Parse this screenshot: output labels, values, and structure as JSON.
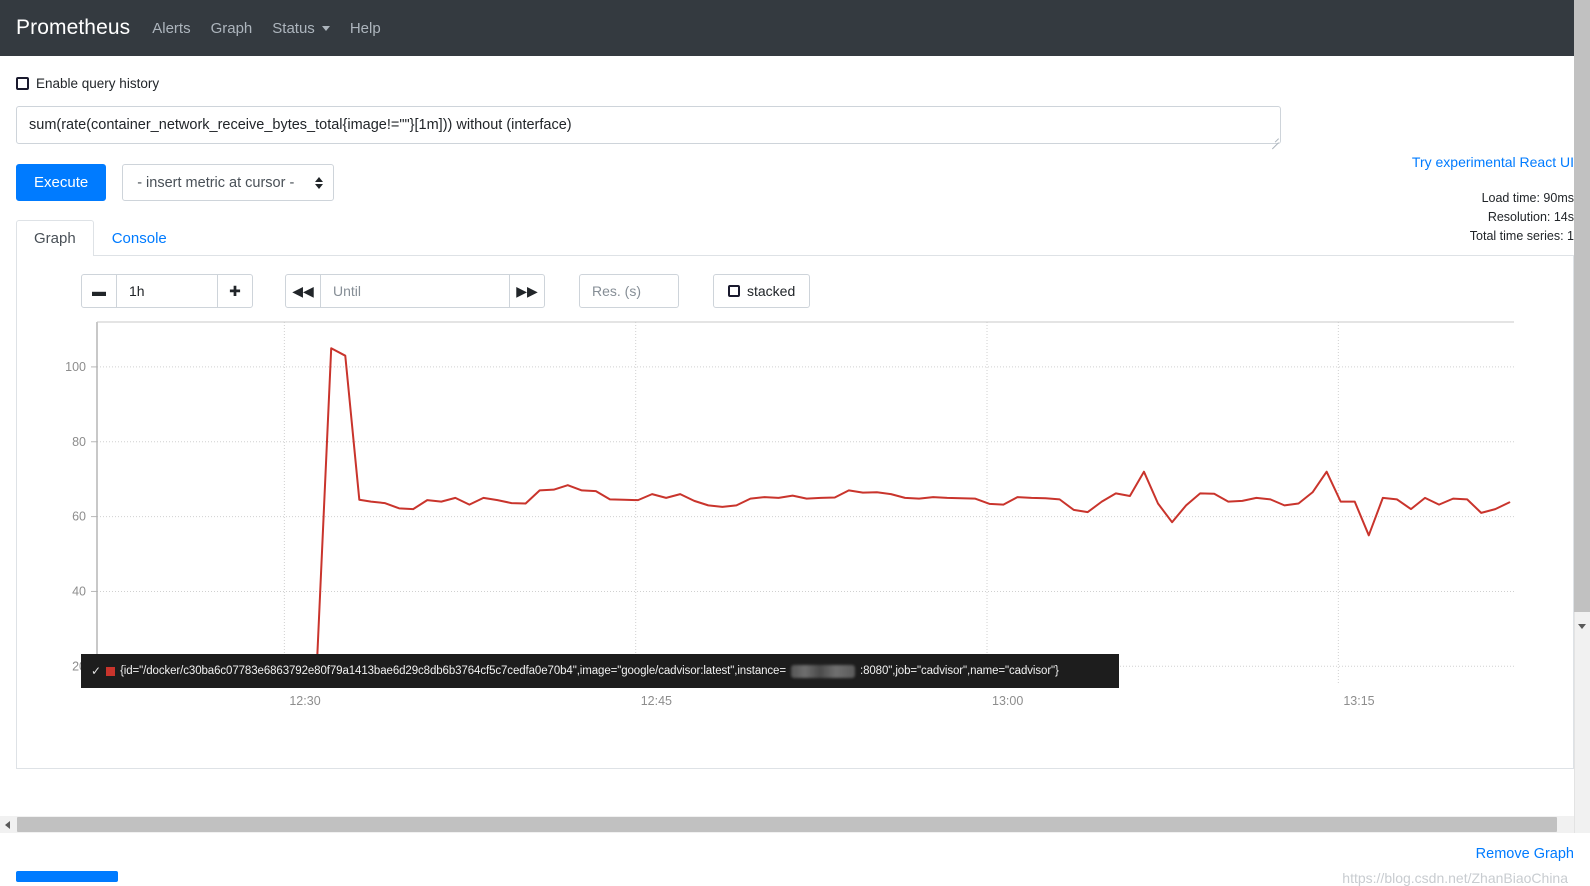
{
  "navbar": {
    "brand": "Prometheus",
    "links": [
      {
        "label": "Alerts",
        "has_caret": false
      },
      {
        "label": "Graph",
        "has_caret": false
      },
      {
        "label": "Status",
        "has_caret": true
      },
      {
        "label": "Help",
        "has_caret": false
      }
    ]
  },
  "query": {
    "history_label": "Enable query history",
    "history_checked": false,
    "expression": "sum(rate(container_network_receive_bytes_total{image!=\"\"}[1m])) without (interface)",
    "execute_label": "Execute",
    "metric_select_value": "- insert metric at cursor -"
  },
  "react_ui_link": "Try experimental React UI",
  "stats": {
    "load_time": "Load time: 90ms",
    "resolution": "Resolution: 14s",
    "total_time_series": "Total time series: 1"
  },
  "tabs": [
    {
      "label": "Graph",
      "active": true
    },
    {
      "label": "Console",
      "active": false
    }
  ],
  "graph_controls": {
    "decrease_range_icon": "minus-icon",
    "range_value": "1h",
    "increase_range_icon": "plus-icon",
    "step_back_icon": "double-left-icon",
    "until_placeholder": "Until",
    "until_value": "",
    "step_forward_icon": "double-right-icon",
    "resolution_placeholder": "Res. (s)",
    "resolution_value": "",
    "stacked_label": "stacked",
    "stacked_checked": false
  },
  "legend": {
    "checkmark": "✓",
    "series_color": "#c9342c",
    "text_before": "{id=\"/docker/c30ba6c07783e6863792e80f79a1413bae6d29c8db6b3764cf5c7cedfa0e70b4\",image=\"google/cadvisor:latest\",instance=",
    "redacted": true,
    "text_after": ":8080\",job=\"cadvisor\",name=\"cadvisor\"}"
  },
  "footer": {
    "remove_graph": "Remove Graph",
    "watermark": "https://blog.csdn.net/ZhanBiaoChina"
  },
  "chart_data": {
    "type": "line",
    "title": "",
    "xlabel": "",
    "ylabel": "",
    "grid": true,
    "legend_position": "bottom",
    "line_color": "#c9342c",
    "xlim": [
      "12:22",
      "13:22"
    ],
    "ylim": [
      15,
      112
    ],
    "ytick_labels": [
      "20",
      "40",
      "60",
      "80",
      "100"
    ],
    "yticks": [
      20,
      40,
      60,
      80,
      100
    ],
    "xtick_labels": [
      "12:30",
      "12:45",
      "13:00",
      "13:15"
    ],
    "xticks": [
      30,
      45,
      60,
      75
    ],
    "series": [
      {
        "name": "{id=\"/docker/c30ba6c07783e6863792e80f79a1413bae6d29c8db6b3764cf5c7cedfa0e70b4\",image=\"google/cadvisor:latest\",job=\"cadvisor\",name=\"cadvisor\"}",
        "x": [
          31.4,
          32.0,
          32.6,
          33.2,
          33.7,
          34.3,
          34.9,
          35.5,
          36.1,
          36.7,
          37.3,
          37.9,
          38.5,
          39.1,
          39.7,
          40.3,
          40.9,
          41.5,
          42.1,
          42.7,
          43.3,
          43.9,
          44.5,
          45.1,
          45.7,
          46.3,
          46.9,
          47.5,
          48.1,
          48.7,
          49.3,
          49.9,
          50.5,
          51.1,
          51.7,
          52.3,
          52.9,
          53.5,
          54.1,
          54.7,
          55.3,
          55.9,
          56.5,
          57.1,
          57.7,
          58.3,
          58.9,
          59.5,
          60.1,
          60.7,
          61.3,
          61.9,
          62.5,
          63.1,
          63.7,
          64.3,
          64.9,
          65.5,
          66.1,
          66.7,
          67.3,
          67.9,
          68.5,
          69.1,
          69.7,
          70.3,
          70.9,
          71.5,
          72.1,
          72.7,
          73.3,
          73.9,
          74.5,
          75.1,
          75.7,
          76.3,
          76.9,
          77.5,
          78.1,
          78.7,
          79.3,
          79.9,
          80.5,
          81.1,
          81.7,
          82.3
        ],
        "values": [
          22.0,
          105.0,
          103.0,
          64.5,
          64.0,
          63.6,
          62.2,
          62.0,
          64.4,
          64.0,
          65.0,
          63.2,
          65.0,
          64.4,
          63.6,
          63.5,
          67.0,
          67.2,
          68.4,
          67.0,
          66.8,
          64.6,
          64.5,
          64.4,
          66.0,
          65.0,
          66.0,
          64.2,
          63.0,
          62.6,
          63.0,
          64.8,
          65.2,
          65.0,
          65.6,
          64.8,
          65.0,
          65.1,
          67.0,
          66.4,
          66.5,
          66.0,
          65.0,
          64.8,
          65.2,
          65.0,
          64.9,
          64.8,
          63.4,
          63.2,
          65.2,
          65.0,
          64.9,
          64.6,
          61.8,
          61.2,
          64.0,
          66.2,
          65.5,
          72.0,
          63.5,
          58.5,
          63.0,
          66.2,
          66.1,
          64.0,
          64.2,
          65.0,
          64.6,
          63.0,
          63.5,
          66.5,
          72.0,
          64.0,
          64.0,
          55.0,
          65.0,
          64.6,
          62.0,
          65.0,
          63.2,
          64.8,
          64.6,
          61.0,
          62.0,
          63.8
        ]
      }
    ]
  }
}
